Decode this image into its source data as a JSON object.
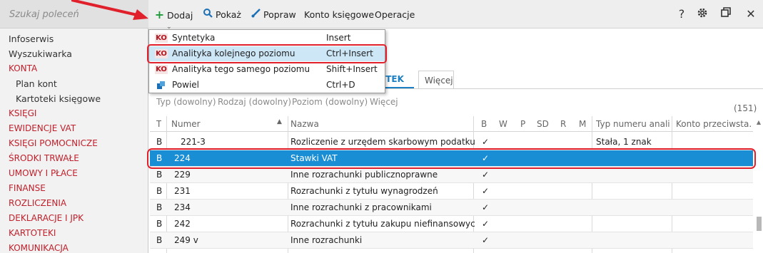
{
  "search": {
    "placeholder": "Szukaj poleceń"
  },
  "sidebar": {
    "items": [
      {
        "label": "Infoserwis",
        "style": "normal"
      },
      {
        "label": "Wyszukiwarka",
        "style": "normal"
      },
      {
        "label": "KONTA",
        "style": "red"
      },
      {
        "label": "Plan kont",
        "style": "sub"
      },
      {
        "label": "Kartoteki księgowe",
        "style": "sub"
      },
      {
        "label": "KSIĘGI",
        "style": "red"
      },
      {
        "label": "EWIDENCJE VAT",
        "style": "red"
      },
      {
        "label": "KSIĘGI POMOCNICZE",
        "style": "red"
      },
      {
        "label": "ŚRODKI TRWAŁE",
        "style": "red"
      },
      {
        "label": "UMOWY I PŁACE",
        "style": "red"
      },
      {
        "label": "FINANSE",
        "style": "red"
      },
      {
        "label": "ROZLICZENIA",
        "style": "red"
      },
      {
        "label": "DEKLARACJE I JPK",
        "style": "red"
      },
      {
        "label": "KARTOTEKI",
        "style": "red"
      },
      {
        "label": "KOMUNIKACJA",
        "style": "red"
      }
    ]
  },
  "toolbar": {
    "dodaj": "Dodaj",
    "pokaz": "Pokaż",
    "popraw": "Popraw",
    "konto": "Konto księgowe",
    "operacje": "Operacje",
    "help": "?",
    "settings_icon": "gear-icon",
    "restore_icon": "restore-window-icon",
    "close": "✕"
  },
  "menu": {
    "items": [
      {
        "badge": "KO",
        "label": "Syntetyka",
        "shortcut": "Insert"
      },
      {
        "badge": "KO",
        "label": "Analityka kolejnego poziomu",
        "shortcut": "Ctrl+Insert"
      },
      {
        "badge": "KO",
        "label": "Analityka tego samego poziomu",
        "shortcut": "Shift+Insert"
      },
      {
        "badge": "",
        "label": "Powiel",
        "shortcut": "Ctrl+D"
      }
    ]
  },
  "tabs": {
    "active_fragment": "OTEK",
    "more": "Więcej"
  },
  "filters": {
    "typ": "Typ (dowolny)",
    "rodzaj": "Rodzaj (dowolny)",
    "poziom": "Poziom (dowolny)",
    "wiecej": "Więcej",
    "count": "(151)"
  },
  "table": {
    "headers": {
      "t": "T",
      "numer": "Numer",
      "nazwa": "Nazwa",
      "b": "B",
      "w": "W",
      "p": "P",
      "sd": "SD",
      "r": "R",
      "m": "M",
      "typ_numeru": "Typ numeru anali...",
      "konto_przeciw": "Konto przeciwsta..."
    },
    "rows": [
      {
        "t": "B",
        "numer": "221-3",
        "nazwa": "Rozliczenie z urzędem skarbowym podatku VAT",
        "b": "✓",
        "typ_numeru": "Stała, 1 znak"
      },
      {
        "t": "B",
        "numer": "224",
        "nazwa": "Stawki VAT",
        "b": "✓",
        "typ_numeru": ""
      },
      {
        "t": "B",
        "numer": "229",
        "nazwa": "Inne rozrachunki publicznoprawne",
        "b": "✓",
        "typ_numeru": ""
      },
      {
        "t": "B",
        "numer": "231",
        "nazwa": "Rozrachunki z tytułu wynagrodzeń",
        "b": "✓",
        "typ_numeru": ""
      },
      {
        "t": "B",
        "numer": "234",
        "nazwa": "Inne rozrachunki z pracownikami",
        "b": "✓",
        "typ_numeru": ""
      },
      {
        "t": "B",
        "numer": "242",
        "nazwa": "Rozrachunki z tytułu zakupu niefinansowych a...",
        "b": "✓",
        "typ_numeru": ""
      },
      {
        "t": "B",
        "numer": "249 v",
        "nazwa": "Inne rozrachunki",
        "b": "✓",
        "typ_numeru": ""
      }
    ],
    "selected_row": 1
  },
  "colors": {
    "accent": "#1a8ed4",
    "brand_red": "#c0202b",
    "annotation_red": "#e0202b"
  }
}
